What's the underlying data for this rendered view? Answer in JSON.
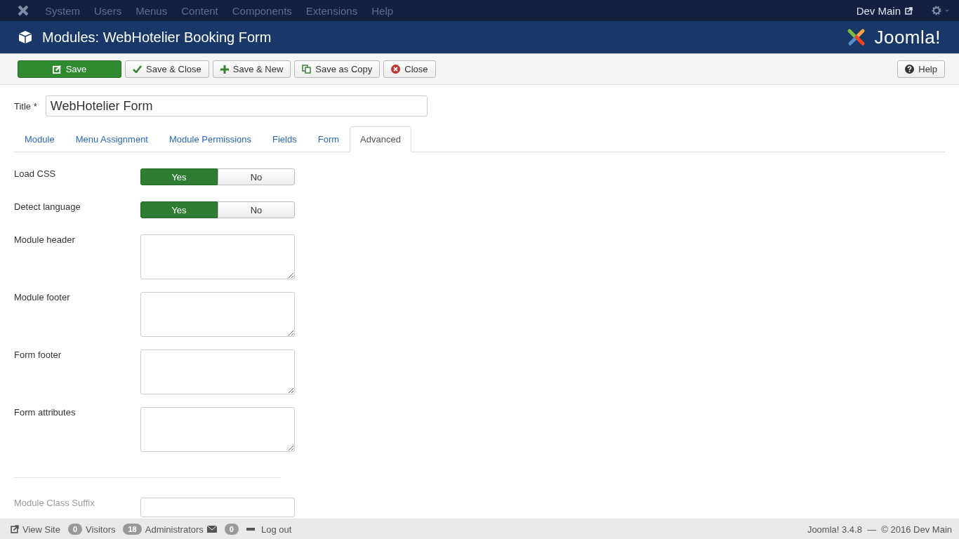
{
  "menu": {
    "items": [
      "System",
      "Users",
      "Menus",
      "Content",
      "Components",
      "Extensions",
      "Help"
    ],
    "site": "Dev Main"
  },
  "header": {
    "title": "Modules: WebHotelier Booking Form",
    "logo_text": "Joomla!"
  },
  "toolbar": {
    "buttons": [
      {
        "label": "Save",
        "kind": "save"
      },
      {
        "label": "Save & Close",
        "kind": "check"
      },
      {
        "label": "Save & New",
        "kind": "plus"
      },
      {
        "label": "Save as Copy",
        "kind": "copy"
      },
      {
        "label": "Close",
        "kind": "close"
      }
    ],
    "help": "Help"
  },
  "title_field": {
    "label": "Title *",
    "value": "WebHotelier Form"
  },
  "tabs": [
    {
      "label": "Module",
      "selected": false
    },
    {
      "label": "Menu Assignment",
      "selected": false
    },
    {
      "label": "Module Permissions",
      "selected": false
    },
    {
      "label": "Fields",
      "selected": false
    },
    {
      "label": "Form",
      "selected": false
    },
    {
      "label": "Advanced",
      "selected": true
    }
  ],
  "fields": [
    {
      "label": "Load CSS",
      "kind": "toggle",
      "options": [
        {
          "label": "Yes",
          "selected": true
        },
        {
          "label": "No",
          "selected": false
        }
      ]
    },
    {
      "label": "Detect language",
      "kind": "toggle",
      "options": [
        {
          "label": "Yes",
          "selected": true
        },
        {
          "label": "No",
          "selected": false
        }
      ]
    },
    {
      "label": "Module header",
      "kind": "textarea"
    },
    {
      "label": "Module footer",
      "kind": "textarea"
    },
    {
      "label": "Form footer",
      "kind": "textarea"
    },
    {
      "label": "Form attributes",
      "kind": "textarea"
    },
    {
      "kind": "divider"
    },
    {
      "label": "Module Class Suffix",
      "kind": "text",
      "disabled": true
    }
  ],
  "status_bar": {
    "view_site": "View Site",
    "visitors_count": "0",
    "visitors": "Visitors",
    "admins_count": "18",
    "admins": "Administrators",
    "messages_count": "0",
    "logout": "Log out",
    "version": "Joomla! 3.4.8  —  © 2016 Dev Main"
  }
}
